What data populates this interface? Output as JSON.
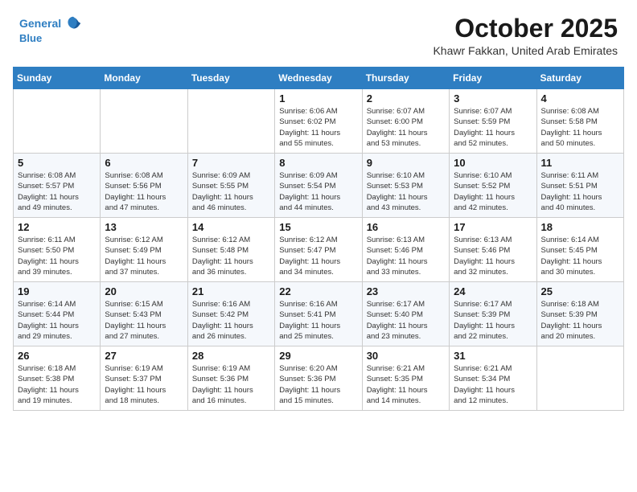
{
  "header": {
    "logo_line1": "General",
    "logo_line2": "Blue",
    "month": "October 2025",
    "location": "Khawr Fakkan, United Arab Emirates"
  },
  "weekdays": [
    "Sunday",
    "Monday",
    "Tuesday",
    "Wednesday",
    "Thursday",
    "Friday",
    "Saturday"
  ],
  "weeks": [
    [
      {
        "day": "",
        "info": ""
      },
      {
        "day": "",
        "info": ""
      },
      {
        "day": "",
        "info": ""
      },
      {
        "day": "1",
        "info": "Sunrise: 6:06 AM\nSunset: 6:02 PM\nDaylight: 11 hours\nand 55 minutes."
      },
      {
        "day": "2",
        "info": "Sunrise: 6:07 AM\nSunset: 6:00 PM\nDaylight: 11 hours\nand 53 minutes."
      },
      {
        "day": "3",
        "info": "Sunrise: 6:07 AM\nSunset: 5:59 PM\nDaylight: 11 hours\nand 52 minutes."
      },
      {
        "day": "4",
        "info": "Sunrise: 6:08 AM\nSunset: 5:58 PM\nDaylight: 11 hours\nand 50 minutes."
      }
    ],
    [
      {
        "day": "5",
        "info": "Sunrise: 6:08 AM\nSunset: 5:57 PM\nDaylight: 11 hours\nand 49 minutes."
      },
      {
        "day": "6",
        "info": "Sunrise: 6:08 AM\nSunset: 5:56 PM\nDaylight: 11 hours\nand 47 minutes."
      },
      {
        "day": "7",
        "info": "Sunrise: 6:09 AM\nSunset: 5:55 PM\nDaylight: 11 hours\nand 46 minutes."
      },
      {
        "day": "8",
        "info": "Sunrise: 6:09 AM\nSunset: 5:54 PM\nDaylight: 11 hours\nand 44 minutes."
      },
      {
        "day": "9",
        "info": "Sunrise: 6:10 AM\nSunset: 5:53 PM\nDaylight: 11 hours\nand 43 minutes."
      },
      {
        "day": "10",
        "info": "Sunrise: 6:10 AM\nSunset: 5:52 PM\nDaylight: 11 hours\nand 42 minutes."
      },
      {
        "day": "11",
        "info": "Sunrise: 6:11 AM\nSunset: 5:51 PM\nDaylight: 11 hours\nand 40 minutes."
      }
    ],
    [
      {
        "day": "12",
        "info": "Sunrise: 6:11 AM\nSunset: 5:50 PM\nDaylight: 11 hours\nand 39 minutes."
      },
      {
        "day": "13",
        "info": "Sunrise: 6:12 AM\nSunset: 5:49 PM\nDaylight: 11 hours\nand 37 minutes."
      },
      {
        "day": "14",
        "info": "Sunrise: 6:12 AM\nSunset: 5:48 PM\nDaylight: 11 hours\nand 36 minutes."
      },
      {
        "day": "15",
        "info": "Sunrise: 6:12 AM\nSunset: 5:47 PM\nDaylight: 11 hours\nand 34 minutes."
      },
      {
        "day": "16",
        "info": "Sunrise: 6:13 AM\nSunset: 5:46 PM\nDaylight: 11 hours\nand 33 minutes."
      },
      {
        "day": "17",
        "info": "Sunrise: 6:13 AM\nSunset: 5:46 PM\nDaylight: 11 hours\nand 32 minutes."
      },
      {
        "day": "18",
        "info": "Sunrise: 6:14 AM\nSunset: 5:45 PM\nDaylight: 11 hours\nand 30 minutes."
      }
    ],
    [
      {
        "day": "19",
        "info": "Sunrise: 6:14 AM\nSunset: 5:44 PM\nDaylight: 11 hours\nand 29 minutes."
      },
      {
        "day": "20",
        "info": "Sunrise: 6:15 AM\nSunset: 5:43 PM\nDaylight: 11 hours\nand 27 minutes."
      },
      {
        "day": "21",
        "info": "Sunrise: 6:16 AM\nSunset: 5:42 PM\nDaylight: 11 hours\nand 26 minutes."
      },
      {
        "day": "22",
        "info": "Sunrise: 6:16 AM\nSunset: 5:41 PM\nDaylight: 11 hours\nand 25 minutes."
      },
      {
        "day": "23",
        "info": "Sunrise: 6:17 AM\nSunset: 5:40 PM\nDaylight: 11 hours\nand 23 minutes."
      },
      {
        "day": "24",
        "info": "Sunrise: 6:17 AM\nSunset: 5:39 PM\nDaylight: 11 hours\nand 22 minutes."
      },
      {
        "day": "25",
        "info": "Sunrise: 6:18 AM\nSunset: 5:39 PM\nDaylight: 11 hours\nand 20 minutes."
      }
    ],
    [
      {
        "day": "26",
        "info": "Sunrise: 6:18 AM\nSunset: 5:38 PM\nDaylight: 11 hours\nand 19 minutes."
      },
      {
        "day": "27",
        "info": "Sunrise: 6:19 AM\nSunset: 5:37 PM\nDaylight: 11 hours\nand 18 minutes."
      },
      {
        "day": "28",
        "info": "Sunrise: 6:19 AM\nSunset: 5:36 PM\nDaylight: 11 hours\nand 16 minutes."
      },
      {
        "day": "29",
        "info": "Sunrise: 6:20 AM\nSunset: 5:36 PM\nDaylight: 11 hours\nand 15 minutes."
      },
      {
        "day": "30",
        "info": "Sunrise: 6:21 AM\nSunset: 5:35 PM\nDaylight: 11 hours\nand 14 minutes."
      },
      {
        "day": "31",
        "info": "Sunrise: 6:21 AM\nSunset: 5:34 PM\nDaylight: 11 hours\nand 12 minutes."
      },
      {
        "day": "",
        "info": ""
      }
    ]
  ]
}
